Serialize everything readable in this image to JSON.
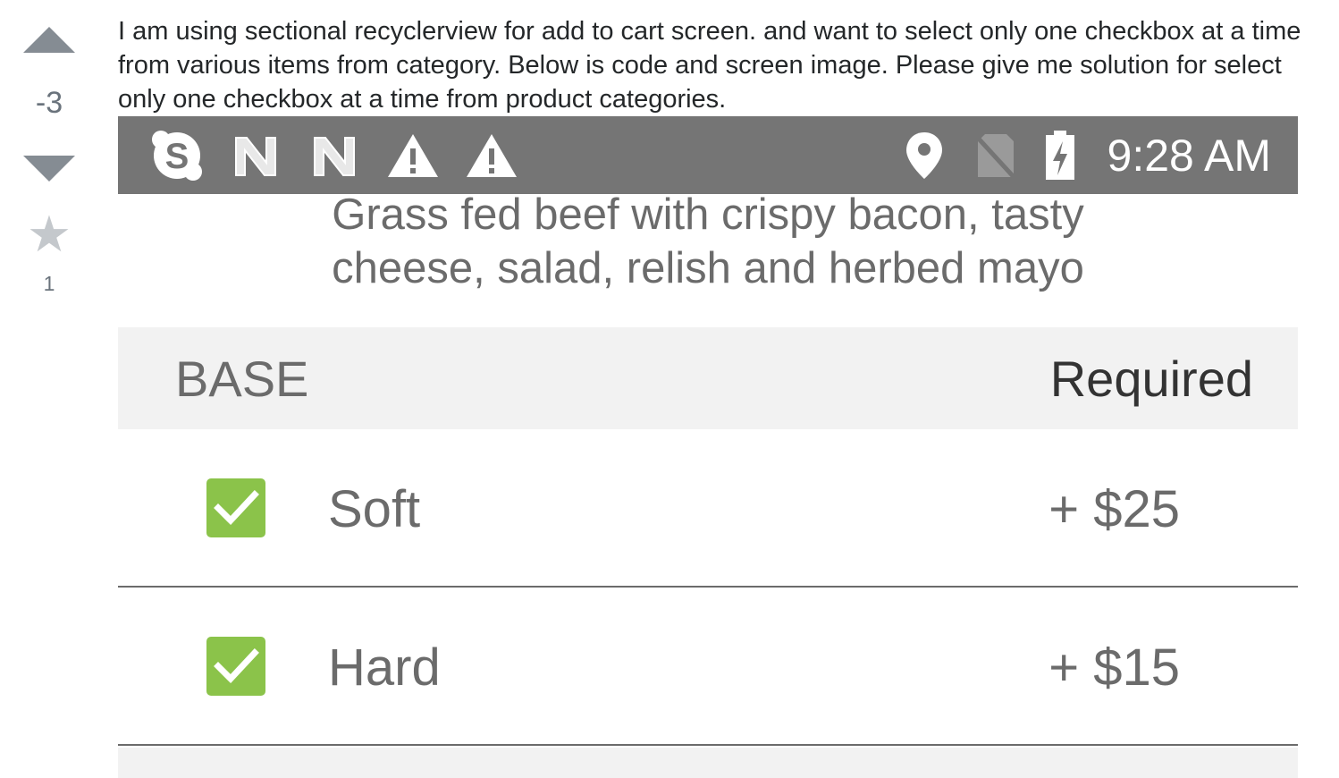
{
  "vote": {
    "score": "-3",
    "favorite_count": "1"
  },
  "question": {
    "body": "I am using sectional recyclerview for add to cart screen. and want to select only one checkbox at a time from various items from category. Below is code and screen image. Please give me solution for select only one checkbox at a time from product categories."
  },
  "screenshot": {
    "status_bar": {
      "time": "9:28 AM",
      "left_icons": [
        "skype-icon",
        "n-notification-icon",
        "n-notification-icon",
        "warning-icon",
        "warning-icon"
      ],
      "right_icons": [
        "location-pin-icon",
        "no-sim-icon",
        "battery-charging-icon"
      ]
    },
    "description": [
      "Grass  fed beef with crispy bacon, tasty",
      "cheese, salad, relish and herbed mayo"
    ],
    "section": {
      "title": "BASE",
      "required_label": "Required"
    },
    "options": [
      {
        "label": "Soft",
        "price": "+ $25",
        "checked": true
      },
      {
        "label": "Hard",
        "price": "+ $15",
        "checked": true
      }
    ],
    "colors": {
      "status_bar": "#757575",
      "checkbox": "#8bc34a",
      "section_bg": "#f2f2f2"
    }
  }
}
